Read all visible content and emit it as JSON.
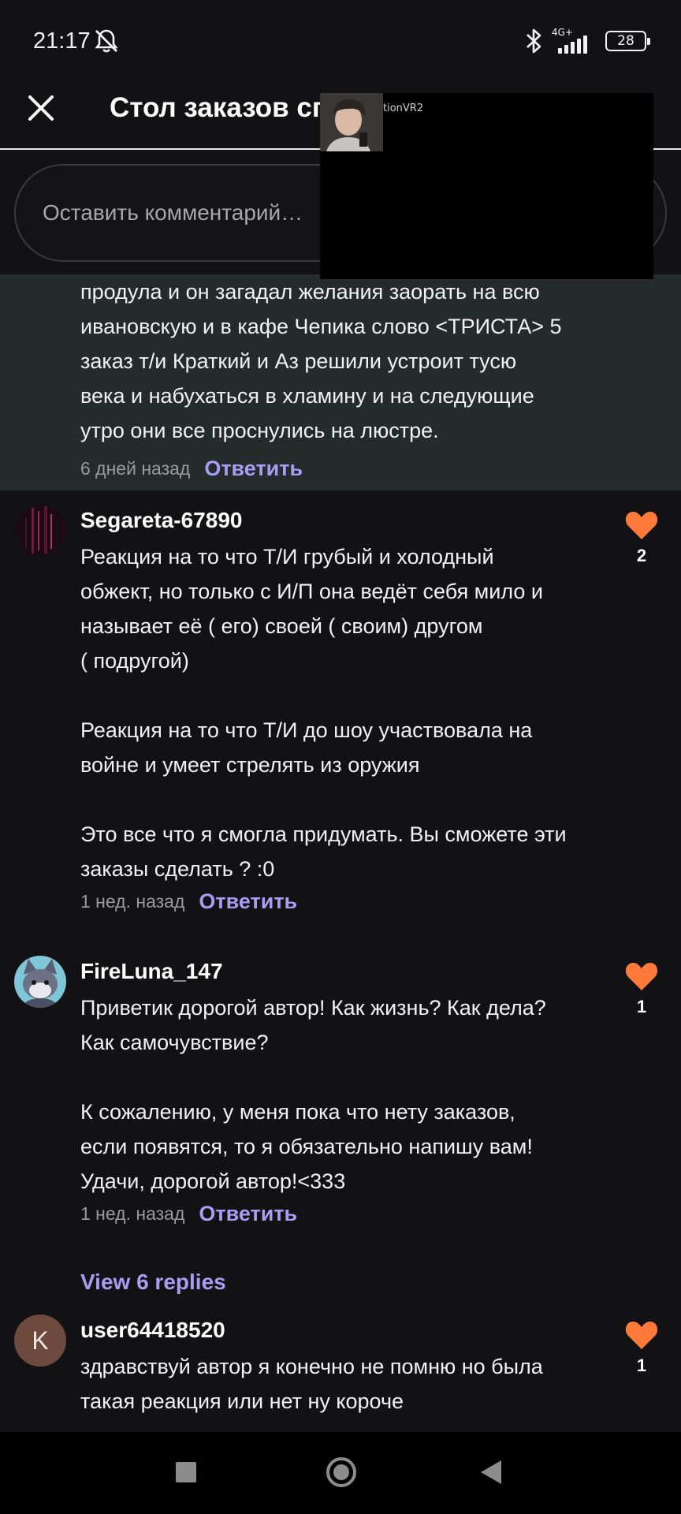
{
  "status": {
    "time": "21:17",
    "network": "4G+",
    "battery": "28"
  },
  "header": {
    "title": "Стол заказов сп"
  },
  "overlay": {
    "label": "tionVR2"
  },
  "comment_input": {
    "placeholder": "Оставить комментарий…"
  },
  "highlighted": {
    "lines": [
      "продула и он загадал желания заорать на всю",
      "ивановскую и в кафе Чепика слово <ТРИСТА> 5",
      "заказ т/и Краткий и Аз решили устроит тусю",
      "века и набухаться в хламину и на следующие",
      "утро они все проснулись на люстре."
    ],
    "time": "6 дней назад",
    "reply": "Ответить"
  },
  "comments": [
    {
      "user": "Segareta-67890",
      "lines": [
        "Реакция на то что Т/И грубый и холодный",
        "обжект, но только с И/П она ведёт себя мило и",
        "называет её ( его) своей ( своим) другом",
        "( подругой)",
        "",
        "Реакция на то что Т/И до шоу участвовала на",
        "войне и умеет стрелять из оружия",
        "",
        "Это все что я смогла придумать. Вы сможете эти",
        "заказы сделать ? :0"
      ],
      "time": "1 нед. назад",
      "reply": "Ответить",
      "likes": "2"
    },
    {
      "user": "FireLuna_147",
      "lines": [
        "Приветик дорогой автор! Как жизнь? Как дела?",
        "Как самочувствие?",
        "",
        "К сожалению, у меня пока что нету заказов,",
        "если появятся, то я обязательно напишу вам!",
        "Удачи, дорогой автор!<333"
      ],
      "time": "1 нед. назад",
      "reply": "Ответить",
      "likes": "1"
    },
    {
      "user": "user64418520",
      "avatar_letter": "K",
      "lines": [
        "здравствуй автор я конечно не помню но была",
        "такая реакция или нет ну короче"
      ],
      "likes": "1"
    }
  ],
  "view_replies": "View 6 replies",
  "colors": {
    "accent": "#a99cf2",
    "heart": "#ff7a3a",
    "highlight_bg": "#252a2b",
    "background": "#121214"
  },
  "icons": [
    "mute-icon",
    "bluetooth-icon",
    "signal-icon",
    "battery-icon",
    "close-icon",
    "heart-icon",
    "nav-recents-icon",
    "nav-home-icon",
    "nav-back-icon"
  ]
}
